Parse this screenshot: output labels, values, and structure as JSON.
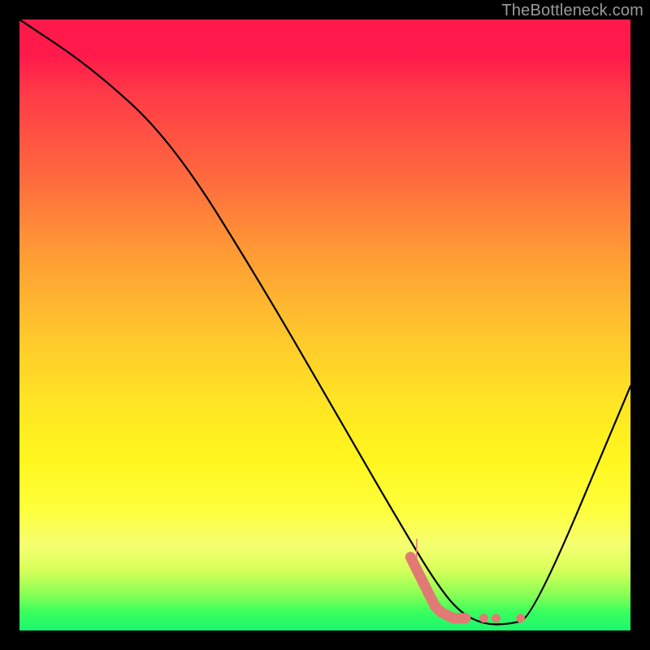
{
  "watermark": {
    "text": "TheBottleneck.com"
  },
  "chart_data": {
    "type": "line",
    "title": "",
    "xlabel": "",
    "ylabel": "",
    "xlim": [
      0,
      100
    ],
    "ylim": [
      0,
      100
    ],
    "grid": false,
    "legend": false,
    "series": [
      {
        "name": "bottleneck-curve",
        "x": [
          0,
          12,
          25,
          40,
          55,
          62,
          68,
          72,
          76,
          80,
          84,
          100
        ],
        "y": [
          100,
          92,
          80,
          56,
          30,
          18,
          8,
          3,
          1,
          1,
          2,
          40
        ]
      }
    ],
    "markers": {
      "name": "optimal-zone",
      "color": "#e17a74",
      "points": [
        {
          "x": 64,
          "y": 12
        },
        {
          "x": 65,
          "y": 10
        },
        {
          "x": 66,
          "y": 8
        },
        {
          "x": 67,
          "y": 6
        },
        {
          "x": 68,
          "y": 4
        },
        {
          "x": 69,
          "y": 3
        },
        {
          "x": 70,
          "y": 2.5
        },
        {
          "x": 71,
          "y": 2
        },
        {
          "x": 73,
          "y": 2
        },
        {
          "x": 76,
          "y": 2
        },
        {
          "x": 78,
          "y": 2
        },
        {
          "x": 82,
          "y": 2
        }
      ]
    },
    "background_gradient": {
      "top": "#ff1a4b",
      "bottom": "#1cf76e"
    }
  }
}
